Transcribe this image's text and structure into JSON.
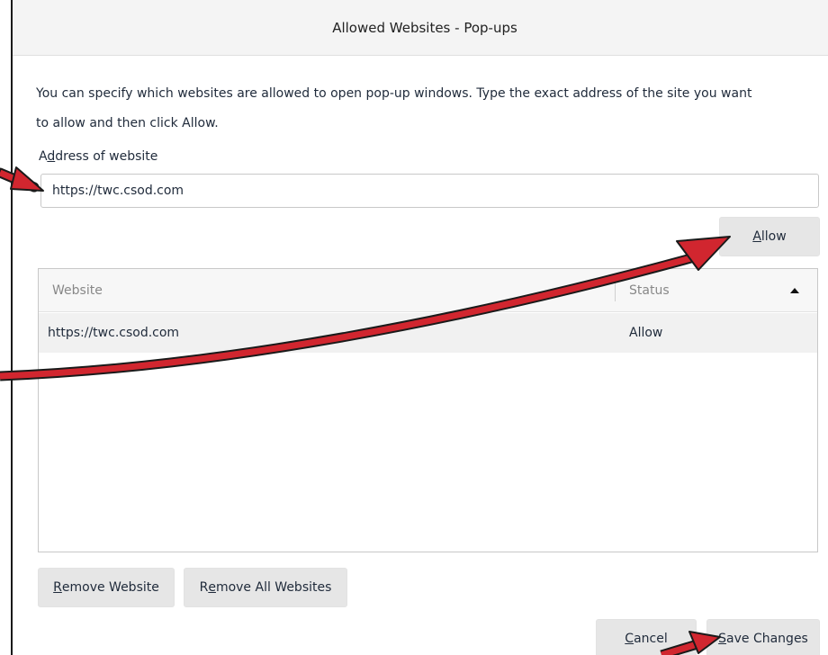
{
  "dialog": {
    "title": "Allowed Websites - Pop-ups",
    "description_line1": "You can specify which websites are allowed to open pop-up windows. Type the exact address of the site you want",
    "description_line2": "to allow and then click Allow.",
    "address_label_prefix": "A",
    "address_label_accel": "d",
    "address_label_rest": "dress of website",
    "address_value": "https://twc.csod.com"
  },
  "buttons": {
    "allow": {
      "accel": "A",
      "rest": "llow"
    },
    "remove_website": {
      "accel": "R",
      "rest": "emove Website"
    },
    "remove_all": {
      "prefix": "R",
      "accel": "e",
      "rest": "move All Websites"
    },
    "cancel": {
      "accel": "C",
      "rest": "ancel"
    },
    "save_changes": {
      "accel": "S",
      "rest": "ave Changes"
    }
  },
  "table": {
    "columns": [
      "Website",
      "Status"
    ],
    "rows": [
      {
        "website": "https://twc.csod.com",
        "status": "Allow"
      }
    ]
  },
  "colors": {
    "annotation_arrow": "#d1262f"
  },
  "icons": {
    "sort": "sort-ascending-icon"
  }
}
